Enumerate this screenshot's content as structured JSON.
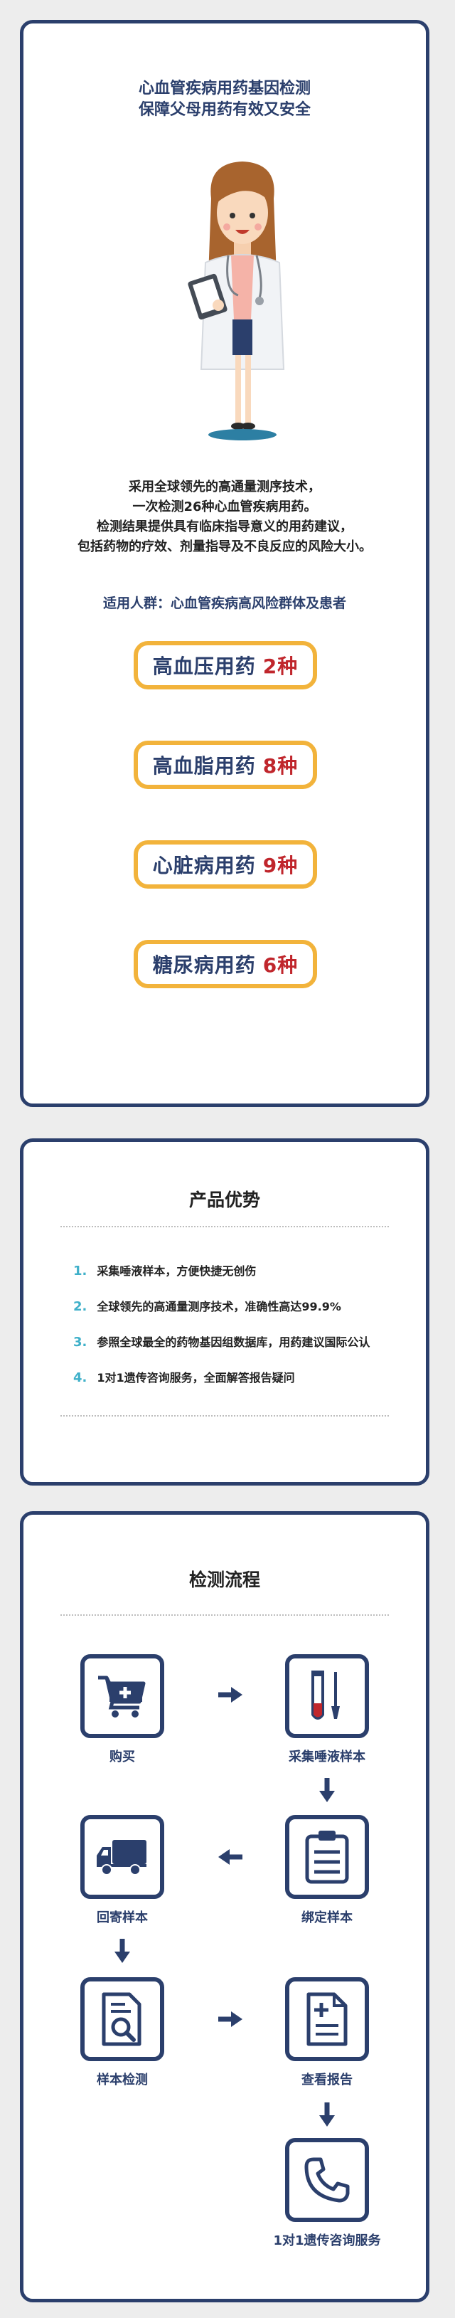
{
  "hero": {
    "title_line1": "心血管疾病用药基因检测",
    "title_line2": "保障父母用药有效又安全"
  },
  "intro": {
    "line1": "采用全球领先的高通量测序技术，",
    "line2": "一次检测26种心血管疾病用药。",
    "line3": "检测结果提供具有临床指导意义的用药建议，",
    "line4": "包括药物的疗效、剂量指导及不良反应的风险大小。"
  },
  "audience": "适用人群：心血管疾病高风险群体及患者",
  "drug_pills": [
    {
      "label": "高血压用药",
      "count": "2种"
    },
    {
      "label": "高血脂用药",
      "count": "8种"
    },
    {
      "label": "心脏病用药",
      "count": "9种"
    },
    {
      "label": "糖尿病用药",
      "count": "6种"
    }
  ],
  "advantages": {
    "title": "产品优势",
    "items": [
      {
        "num": "1.",
        "text": "采集唾液样本，方便快捷无创伤"
      },
      {
        "num": "2.",
        "text": "全球领先的高通量测序技术，准确性高达99.9%"
      },
      {
        "num": "3.",
        "text": "参照全球最全的药物基因组数据库，用药建议国际公认"
      },
      {
        "num": "4.",
        "text": "1对1遗传咨询服务，全面解答报告疑问"
      }
    ]
  },
  "process": {
    "title": "检测流程",
    "steps": [
      {
        "label": "购买",
        "icon": "shopping-cart-icon"
      },
      {
        "label": "采集唾液样本",
        "icon": "test-tube-icon"
      },
      {
        "label": "绑定样本",
        "icon": "clipboard-icon"
      },
      {
        "label": "回寄样本",
        "icon": "delivery-truck-icon"
      },
      {
        "label": "样本检测",
        "icon": "document-magnifier-icon"
      },
      {
        "label": "查看报告",
        "icon": "report-icon"
      },
      {
        "label": "1对1遗传咨询服务",
        "icon": "phone-icon"
      }
    ]
  },
  "colors": {
    "navy": "#2b3f6c",
    "accent_orange": "#f2b33b",
    "accent_red": "#c0262c",
    "number_teal": "#3fb0c9",
    "background": "#ededed"
  }
}
